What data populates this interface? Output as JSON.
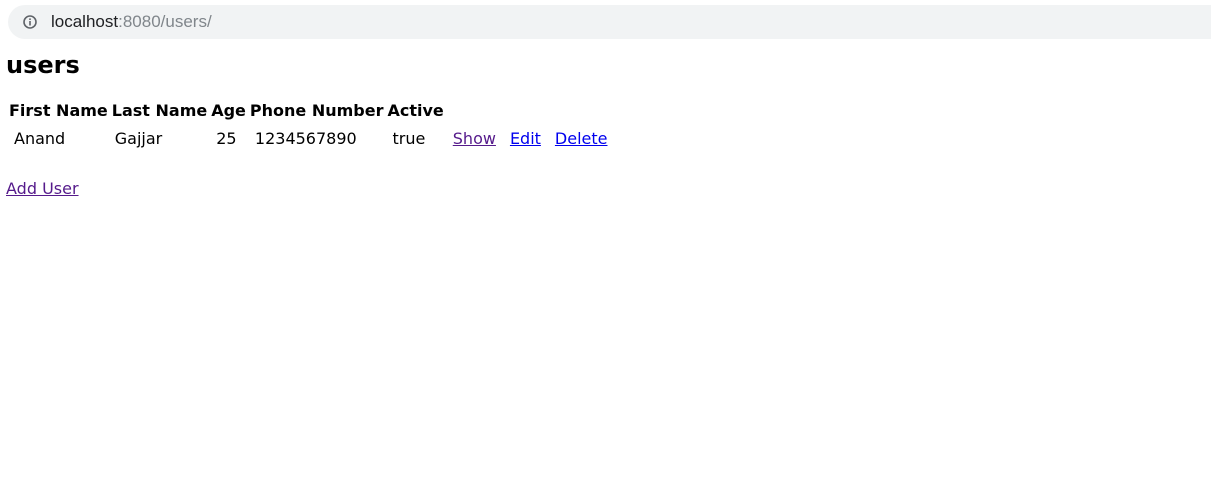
{
  "browser": {
    "url_host": "localhost",
    "url_path": ":8080/users/",
    "info_icon": "info-circle-icon"
  },
  "page": {
    "title": "users"
  },
  "table": {
    "headers": [
      "First Name",
      "Last Name",
      "Age",
      "Phone Number",
      "Active"
    ],
    "rows": [
      {
        "first_name": "Anand",
        "last_name": "Gajjar",
        "age": "25",
        "phone_number": "1234567890",
        "active": "true",
        "show_label": "Show",
        "edit_label": "Edit",
        "delete_label": "Delete"
      }
    ]
  },
  "links": {
    "add_user_label": "Add User"
  },
  "colors": {
    "link_visited": "#551a8b",
    "link_unvisited": "#0000ee",
    "url_bar_bg": "#f1f3f4"
  }
}
